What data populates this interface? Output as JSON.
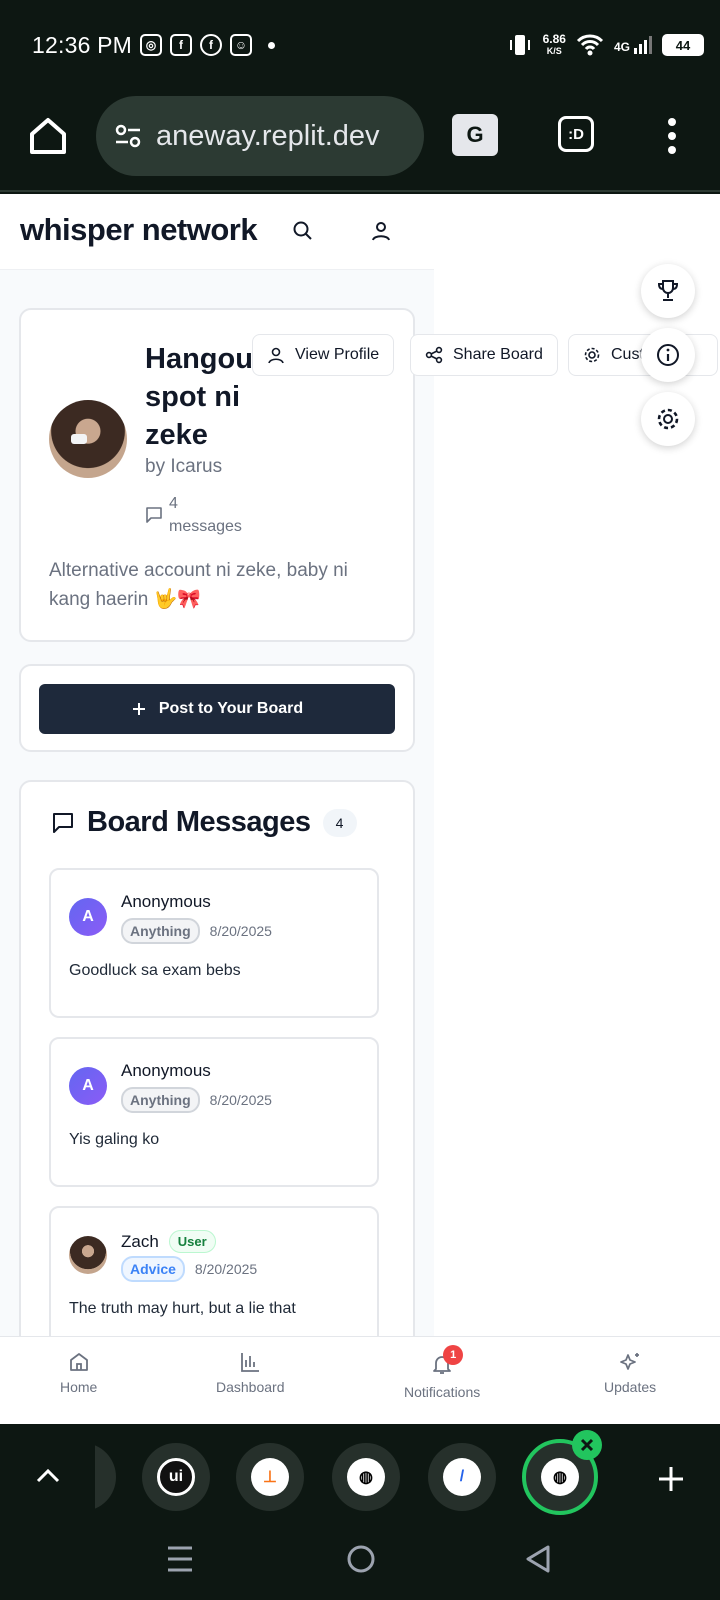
{
  "status": {
    "time": "12:36 PM",
    "netspeed": "6.86",
    "netspeed_unit": "K/S",
    "network": "4G",
    "battery": "44"
  },
  "browser": {
    "url": "aneway.replit.dev"
  },
  "header": {
    "brand": "whisper network"
  },
  "board": {
    "title": "Hangout spot ni zeke",
    "by": "by Icarus",
    "message_count": "4",
    "message_count_label": "messages",
    "description": "Alternative account ni zeke, baby ni kang haerin 🤟🎀"
  },
  "actions": {
    "view_profile": "View Profile",
    "share_board": "Share Board",
    "customize": "Customize"
  },
  "post_button": "Post to Your Board",
  "messages": {
    "title": "Board Messages",
    "count": "4",
    "items": [
      {
        "initial": "A",
        "author": "Anonymous",
        "role": "",
        "tag": "Anything",
        "date": "8/20/2025",
        "text": "Goodluck sa exam bebs"
      },
      {
        "initial": "A",
        "author": "Anonymous",
        "role": "",
        "tag": "Anything",
        "date": "8/20/2025",
        "text": "Yis galing ko"
      },
      {
        "initial": "",
        "author": "Zach",
        "role": "User",
        "tag": "Advice",
        "date": "8/20/2025",
        "text": "The truth may hurt, but a lie that"
      }
    ]
  },
  "bottom_nav": {
    "home": "Home",
    "dashboard": "Dashboard",
    "notifications": "Notifications",
    "notifications_badge": "1",
    "updates": "Updates"
  },
  "colors": {
    "primary_dark": "#1e293b",
    "accent_green": "#22c55e",
    "avatar_gradient": "#6366f1"
  }
}
